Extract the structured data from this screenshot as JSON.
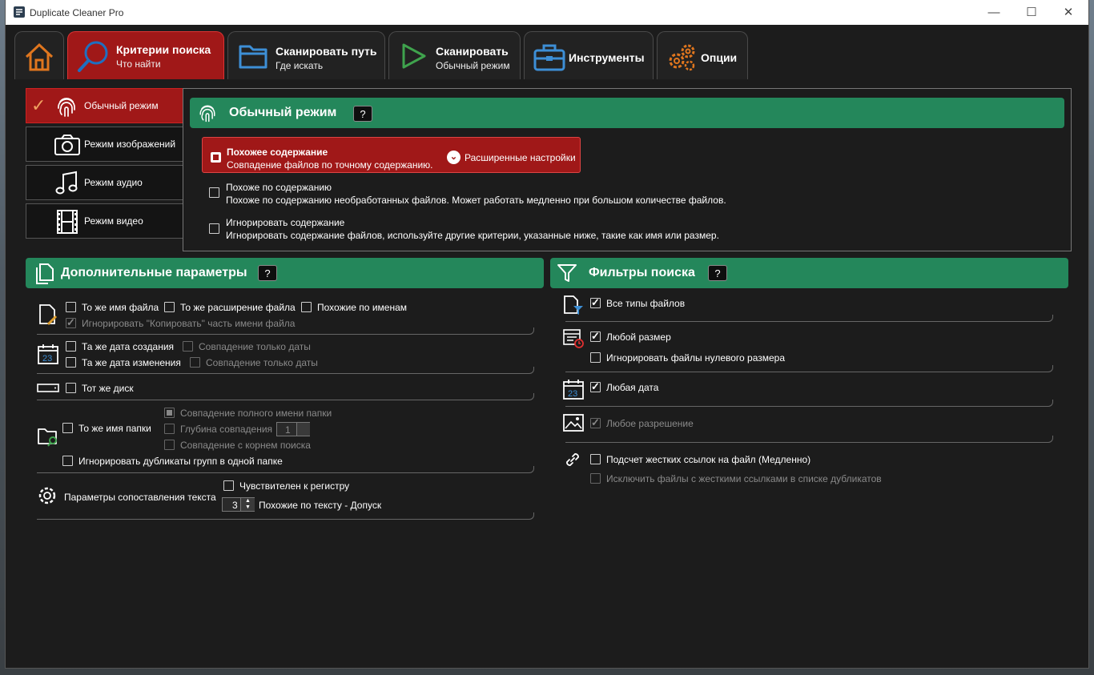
{
  "window": {
    "title": "Duplicate Cleaner Pro"
  },
  "tabs": [
    {
      "title": "",
      "subtitle": "",
      "icon": "home-icon"
    },
    {
      "title": "Критерии поиска",
      "subtitle": "Что найти",
      "icon": "search-icon"
    },
    {
      "title": "Сканировать путь",
      "subtitle": "Где искать",
      "icon": "folder-icon"
    },
    {
      "title": "Сканировать",
      "subtitle": "Обычный режим",
      "icon": "play-icon"
    },
    {
      "title": "Инструменты",
      "subtitle": "",
      "icon": "toolbox-icon"
    },
    {
      "title": "Опции",
      "subtitle": "",
      "icon": "gears-icon"
    }
  ],
  "modes": [
    {
      "label": "Обычный режим",
      "icon": "fingerprint-icon",
      "active": true
    },
    {
      "label": "Режим изображений",
      "icon": "camera-icon",
      "active": false
    },
    {
      "label": "Режим аудио",
      "icon": "music-note-icon",
      "active": false
    },
    {
      "label": "Режим видео",
      "icon": "film-icon",
      "active": false
    }
  ],
  "normal_mode": {
    "title": "Обычный режим",
    "help": "?",
    "options": [
      {
        "title": "Похожее содержание",
        "desc": "Совпадение файлов по точному содержанию.",
        "selected": true
      },
      {
        "title": "Похоже по содержанию",
        "desc": "Похоже по содержанию необработанных файлов. Может работать медленно при большом количестве файлов.",
        "selected": false
      },
      {
        "title": "Игнорировать содержание",
        "desc": "Игнорировать содержание файлов, используйте другие критерии, указанные ниже, такие как имя или размер.",
        "selected": false
      }
    ],
    "advanced_label": "Расширенные настройки"
  },
  "extra": {
    "title": "Дополнительные параметры",
    "help": "?",
    "same_name": "То же имя файла",
    "same_ext": "То же расширение файла",
    "similar_names": "Похожие по именам",
    "ignore_copy": "Игнорировать \"Копировать\" часть имени файла",
    "same_created": "Та же дата создания",
    "date_only_1": "Совпадение только даты",
    "same_modified": "Та же дата изменения",
    "date_only_2": "Совпадение только даты",
    "same_disk": "Тот же диск",
    "same_folder": "То же имя папки",
    "full_folder": "Совпадение полного имени папки",
    "match_depth": "Глубина совпадения",
    "depth_value": "1",
    "root_match": "Совпадение с корнем поиска",
    "ignore_same_folder": "Игнорировать дубликаты групп в одной папке",
    "text_params": "Параметры сопоставления текста",
    "case_sensitive": "Чувствителен к регистру",
    "tolerance_value": "3",
    "tolerance_label": "Похожие по тексту - Допуск"
  },
  "filters": {
    "title": "Фильтры поиска",
    "help": "?",
    "all_types": "Все типы файлов",
    "any_size": "Любой размер",
    "ignore_zero": "Игнорировать файлы нулевого размера",
    "any_date": "Любая дата",
    "any_resolution": "Любое разрешение",
    "hardlinks": "Подсчет жестких ссылок на файл (Медленно)",
    "exclude_hardlinks": "Исключить файлы с жесткими ссылками в списке дубликатов"
  },
  "colors": {
    "accent_red": "#a01818",
    "green_header": "#24875b",
    "icon_orange": "#e0761e",
    "icon_blue": "#3d8fd6",
    "icon_green": "#3fa34d"
  }
}
